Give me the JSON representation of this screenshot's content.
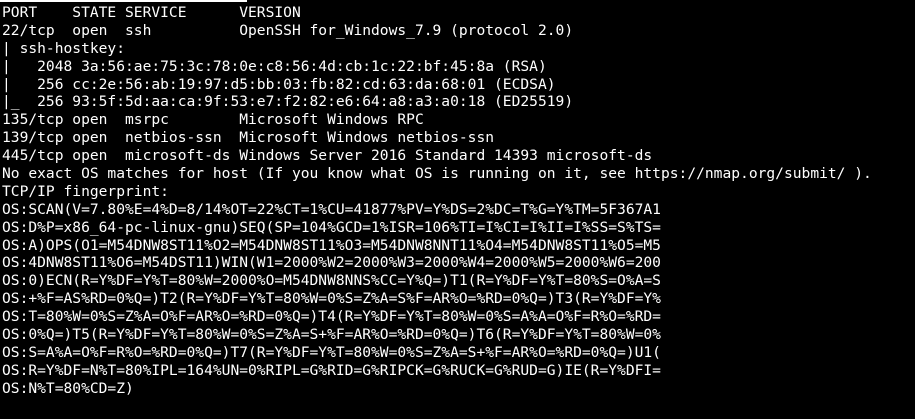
{
  "terminal": {
    "text_color": "#ffffff",
    "background_color": "#000000",
    "lines": [
      "PORT    STATE SERVICE      VERSION",
      "22/tcp  open  ssh          OpenSSH for_Windows_7.9 (protocol 2.0)",
      "| ssh-hostkey:",
      "|   2048 3a:56:ae:75:3c:78:0e:c8:56:4d:cb:1c:22:bf:45:8a (RSA)",
      "|   256 cc:2e:56:ab:19:97:d5:bb:03:fb:82:cd:63:da:68:01 (ECDSA)",
      "|_  256 93:5f:5d:aa:ca:9f:53:e7:f2:82:e6:64:a8:a3:a0:18 (ED25519)",
      "135/tcp open  msrpc        Microsoft Windows RPC",
      "139/tcp open  netbios-ssn  Microsoft Windows netbios-ssn",
      "445/tcp open  microsoft-ds Windows Server 2016 Standard 14393 microsoft-ds",
      "No exact OS matches for host (If you know what OS is running on it, see https://nmap.org/submit/ ).",
      "TCP/IP fingerprint:",
      "OS:SCAN(V=7.80%E=4%D=8/14%OT=22%CT=1%CU=41877%PV=Y%DS=2%DC=T%G=Y%TM=5F367A1",
      "OS:D%P=x86_64-pc-linux-gnu)SEQ(SP=104%GCD=1%ISR=106%TI=I%CI=I%II=I%SS=S%TS=",
      "OS:A)OPS(O1=M54DNW8ST11%O2=M54DNW8ST11%O3=M54DNW8NNT11%O4=M54DNW8ST11%O5=M5",
      "OS:4DNW8ST11%O6=M54DST11)WIN(W1=2000%W2=2000%W3=2000%W4=2000%W5=2000%W6=200",
      "OS:0)ECN(R=Y%DF=Y%T=80%W=2000%O=M54DNW8NNS%CC=Y%Q=)T1(R=Y%DF=Y%T=80%S=O%A=S",
      "OS:+%F=AS%RD=0%Q=)T2(R=Y%DF=Y%T=80%W=0%S=Z%A=S%F=AR%O=%RD=0%Q=)T3(R=Y%DF=Y%",
      "OS:T=80%W=0%S=Z%A=O%F=AR%O=%RD=0%Q=)T4(R=Y%DF=Y%T=80%W=0%S=A%A=O%F=R%O=%RD=",
      "OS:0%Q=)T5(R=Y%DF=Y%T=80%W=0%S=Z%A=S+%F=AR%O=%RD=0%Q=)T6(R=Y%DF=Y%T=80%W=0%",
      "OS:S=A%A=O%F=R%O=%RD=0%Q=)T7(R=Y%DF=Y%T=80%W=0%S=Z%A=S+%F=AR%O=%RD=0%Q=)U1(",
      "OS:R=Y%DF=N%T=80%IPL=164%UN=0%RIPL=G%RID=G%RIPCK=G%RUCK=G%RUD=G)IE(R=Y%DFI=",
      "OS:N%T=80%CD=Z)"
    ]
  }
}
